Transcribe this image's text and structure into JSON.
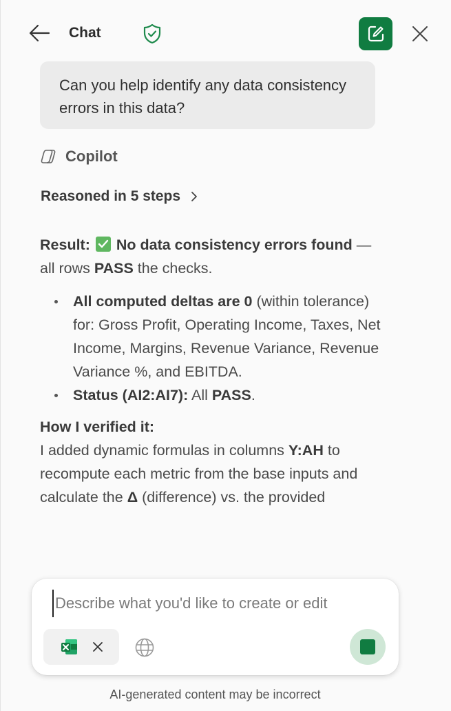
{
  "header": {
    "title": "Chat",
    "back_icon": "arrow-left-icon",
    "shield_icon": "shield-check-icon",
    "new_chat_icon": "compose-icon",
    "close_icon": "close-icon"
  },
  "colors": {
    "accent": "#107c41",
    "panel_bg": "#fafafa",
    "bubble_bg": "#ebebeb",
    "stop_bg": "#cfe7d6",
    "check_green": "#5fb760"
  },
  "conversation": {
    "user_message": "Can you help identify any data consistency errors in this data?",
    "assistant_name": "Copilot",
    "reasoned_label": "Reasoned in 5 steps",
    "result_label": "Result:",
    "result_headline": "No data consistency errors found",
    "result_tail_1": "— all rows ",
    "result_tail_bold": "PASS",
    "result_tail_2": " the checks.",
    "bullet1_bold": "All computed deltas are 0",
    "bullet1_text": " (within tolerance) for: Gross Profit, Operating Income, Taxes, Net Income, Margins, Revenue Variance, Revenue Variance %, and EBITDA.",
    "bullet2_bold": "Status (AI2:AI7):",
    "bullet2_text": " All ",
    "bullet2_bold2": "PASS",
    "bullet2_end": ".",
    "verify_title": "How I verified it:",
    "verify_text_1": "I added dynamic formulas in columns ",
    "verify_bold_1": "Y:AH",
    "verify_text_2": " to recompute each metric from the base inputs and calculate the ",
    "verify_bold_2": "Δ",
    "verify_text_3": " (difference) vs. the provided"
  },
  "composer": {
    "placeholder": "Describe what you'd like to create or edit",
    "value": "",
    "attachment_icon": "excel-file-icon",
    "remove_attachment_icon": "close-icon",
    "web_icon": "globe-icon",
    "stop_icon": "stop-icon"
  },
  "footer": {
    "disclaimer": "AI-generated content may be incorrect"
  }
}
